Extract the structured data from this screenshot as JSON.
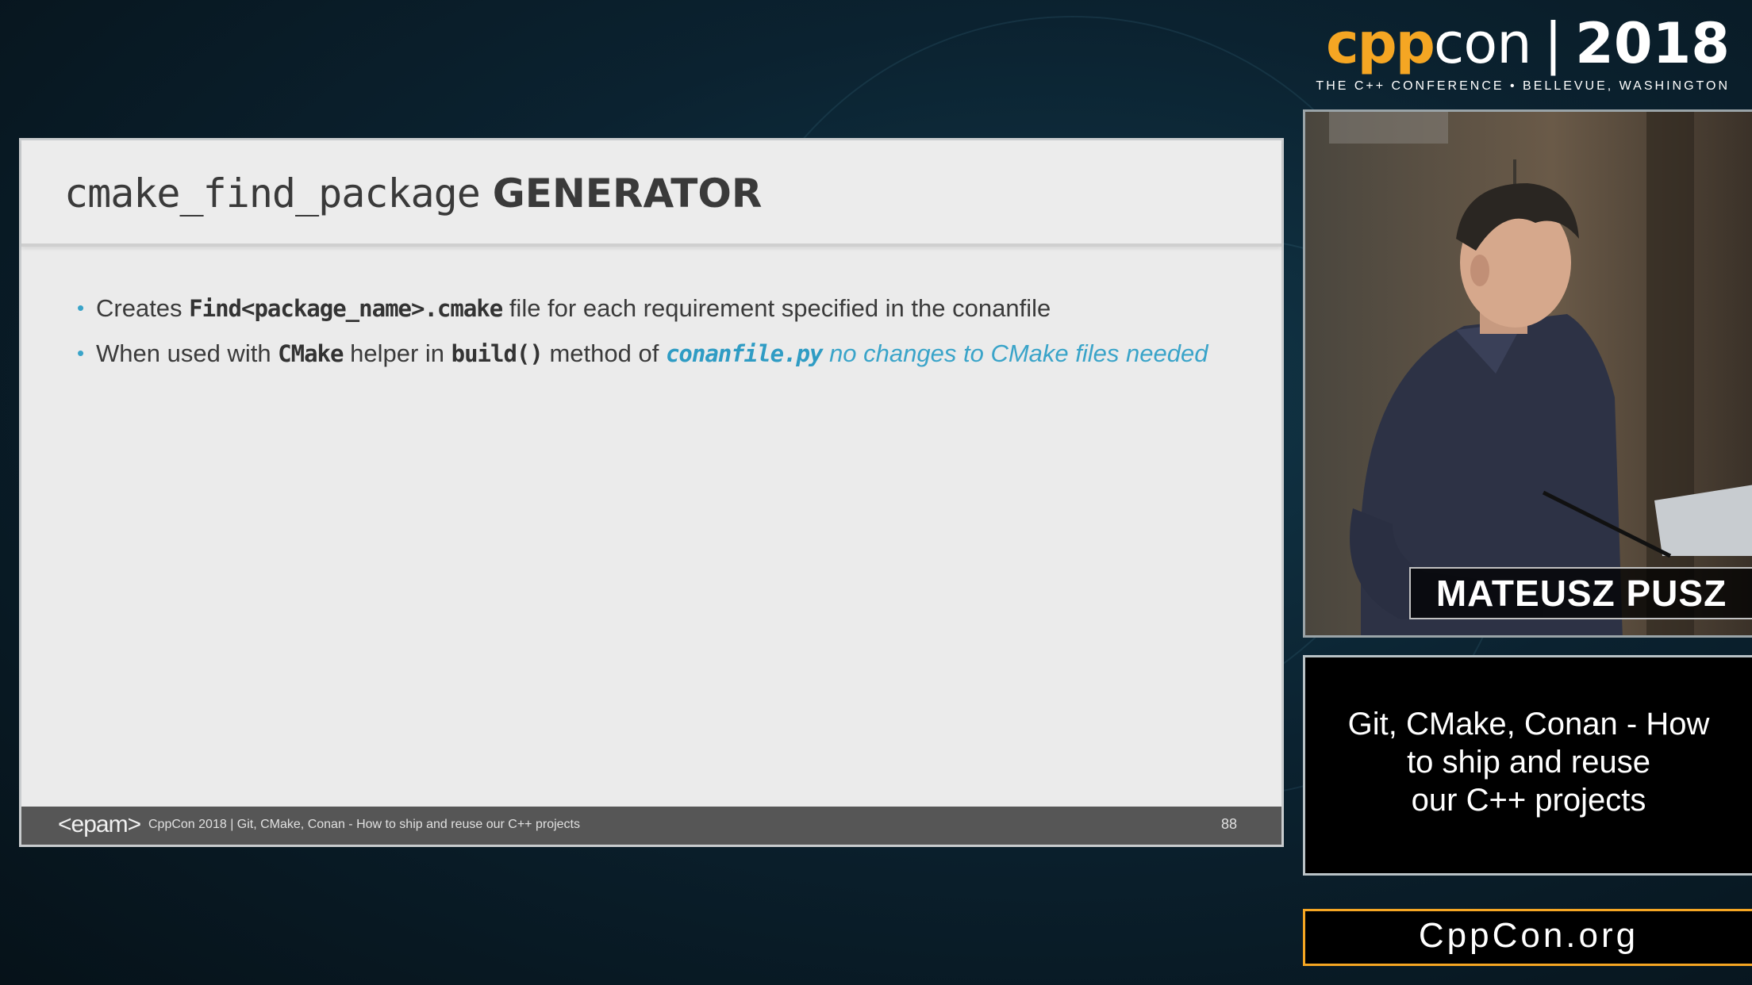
{
  "branding": {
    "cpp": "cpp",
    "con": "con",
    "separator": "|",
    "year": "2018",
    "subtitle": "THE C++ CONFERENCE • BELLEVUE, WASHINGTON"
  },
  "slide": {
    "title_mono": "cmake_find_package",
    "title_bold": "GENERATOR",
    "bullets": [
      {
        "t1": "Creates ",
        "code1": "Find<package_name>.cmake",
        "t2": " file for each requirement specified in the conanfile"
      },
      {
        "t1": "When used with ",
        "code1": "CMake",
        "t2": " helper in ",
        "code2": "build()",
        "t3": " method of ",
        "accent_code": "conanfile.py",
        "accent_text": " no changes to CMake files needed"
      }
    ],
    "footer": {
      "logo": "<epam>",
      "text": "CppCon 2018 | Git, CMake, Conan - How to ship and reuse our C++ projects",
      "page": "88"
    }
  },
  "video": {
    "speaker_name": "MATEUSZ PUSZ"
  },
  "talk": {
    "title": "Git, CMake, Conan - How\nto ship and reuse\nour C++ projects"
  },
  "site": {
    "url": "CppCon.org"
  },
  "colors": {
    "accent_orange": "#f5a623",
    "accent_blue": "#3aa4c9",
    "slide_bg": "#ebebeb"
  }
}
